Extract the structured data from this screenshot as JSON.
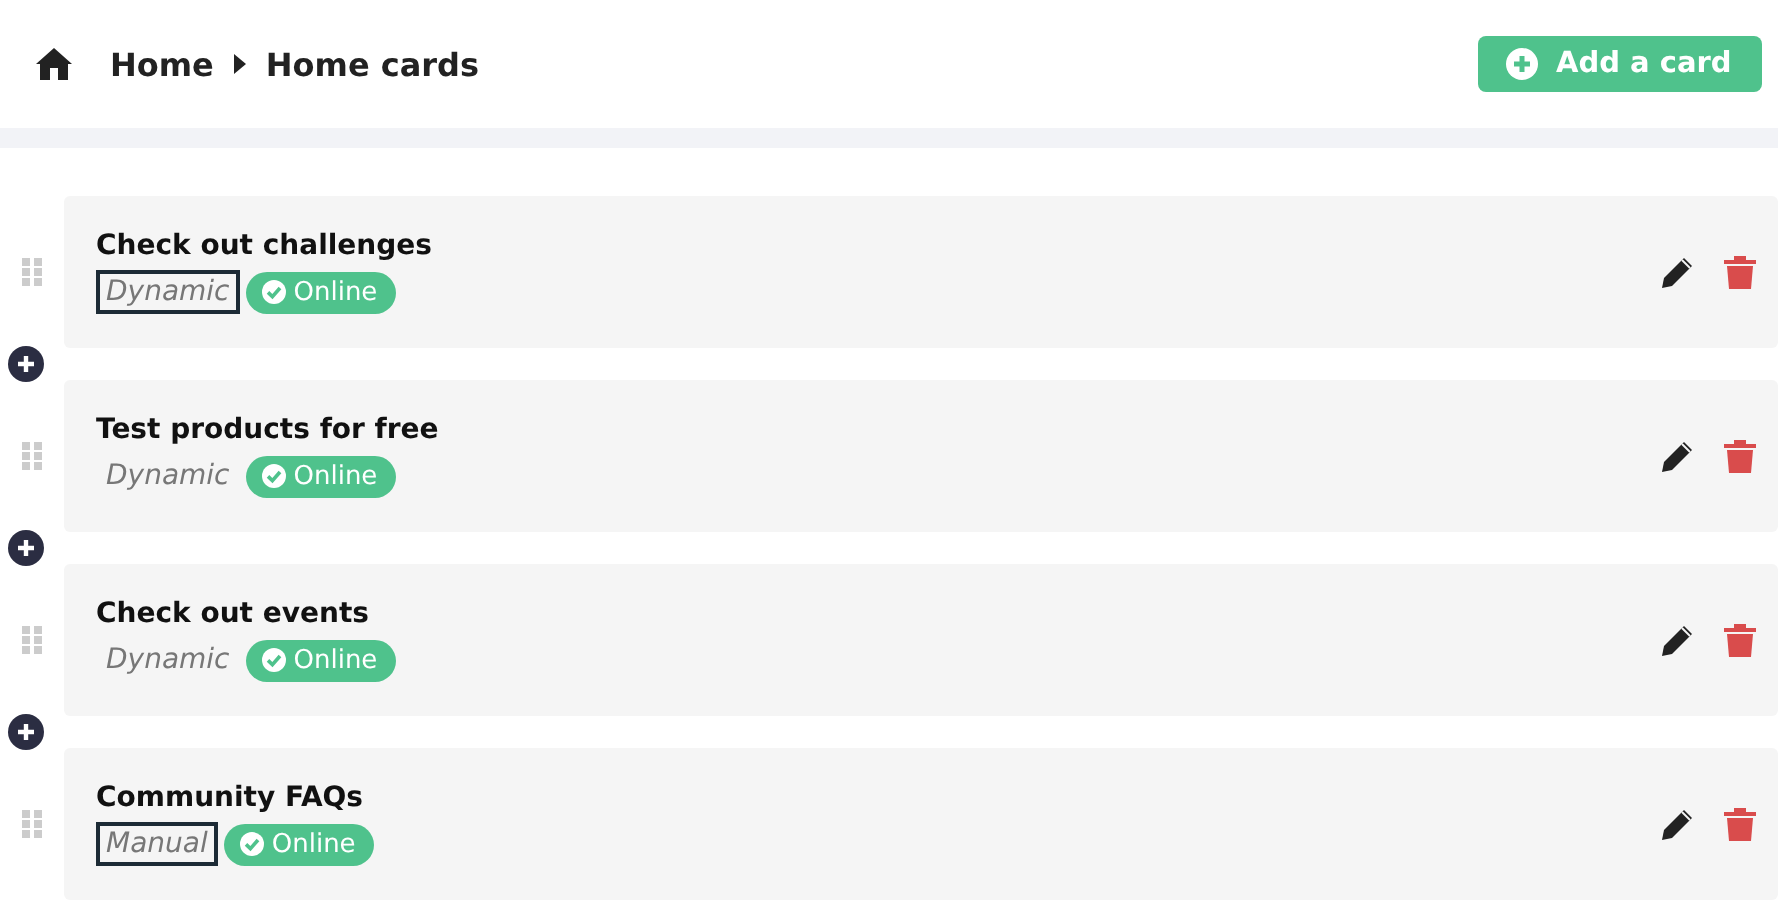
{
  "breadcrumb": [
    "Home",
    "Home cards"
  ],
  "add_button": {
    "label": "Add a card"
  },
  "cards": [
    {
      "title": "Check out challenges",
      "type": "Dynamic",
      "type_selected": true,
      "status": "Online"
    },
    {
      "title": "Test products for free",
      "type": "Dynamic",
      "type_selected": false,
      "status": "Online"
    },
    {
      "title": "Check out events",
      "type": "Dynamic",
      "type_selected": false,
      "status": "Online"
    },
    {
      "title": "Community FAQs",
      "type": "Manual",
      "type_selected": true,
      "status": "Online"
    }
  ]
}
